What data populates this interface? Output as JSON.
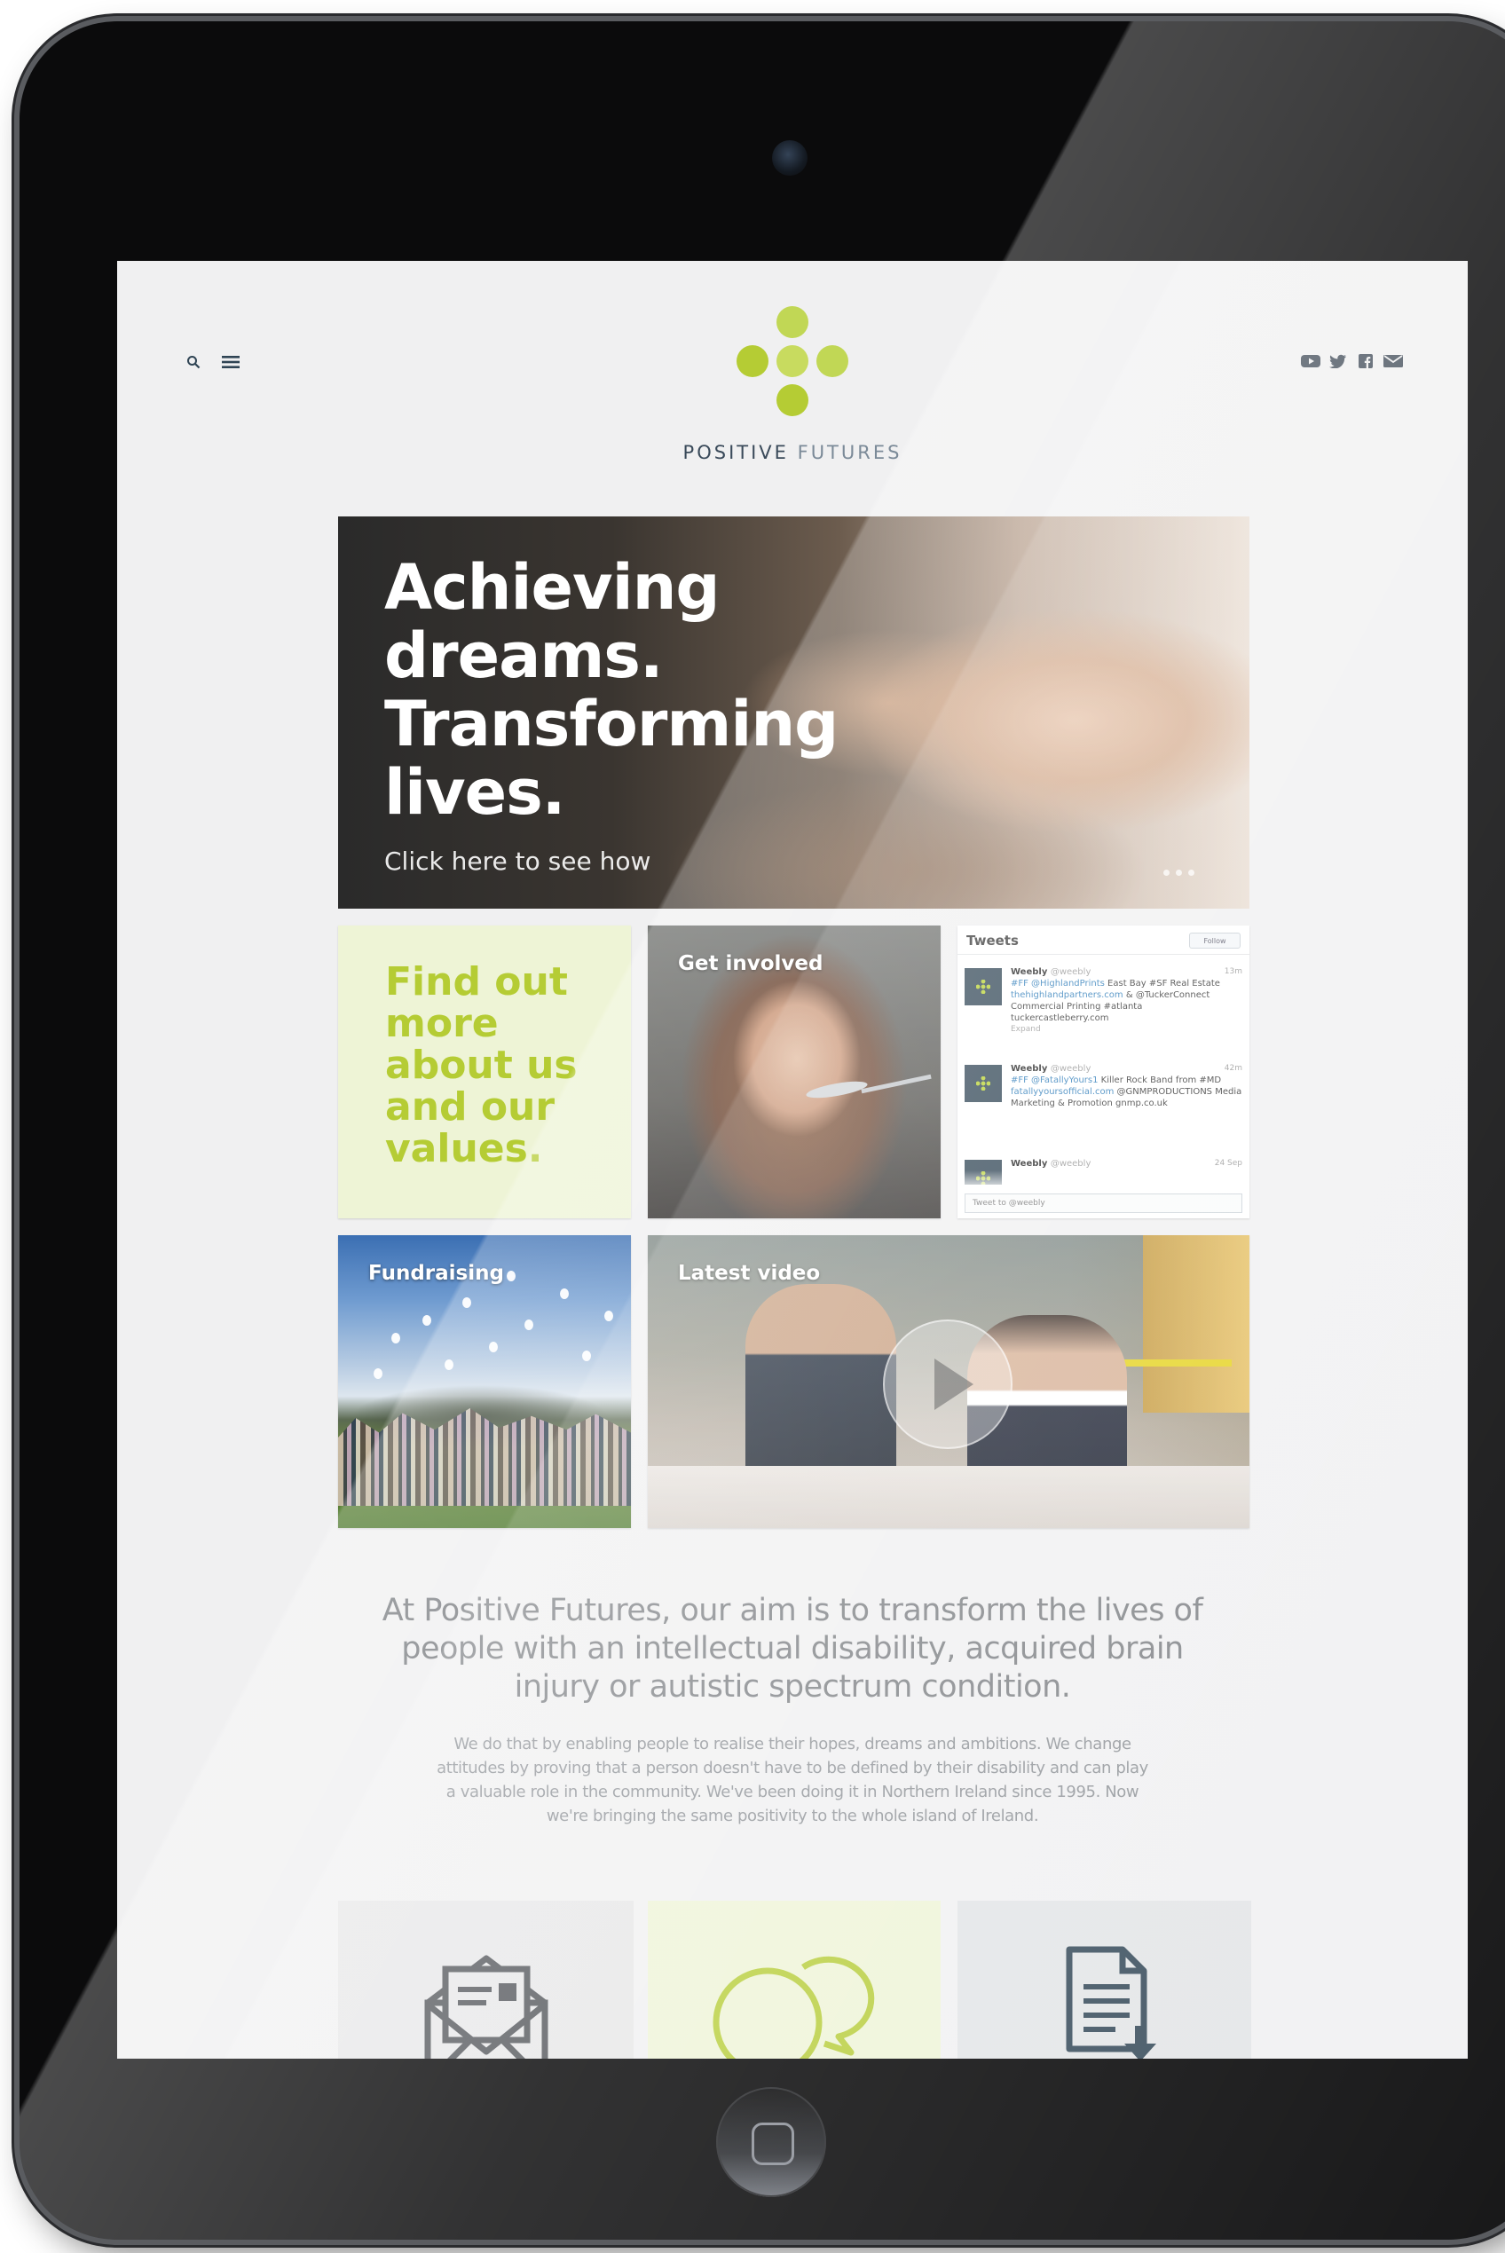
{
  "header": {
    "brand_name_bold": "POSITIVE",
    "brand_name_light": "FUTURES",
    "left_icons": [
      "search-icon",
      "menu-icon"
    ],
    "social_icons": [
      "youtube-icon",
      "twitter-icon",
      "facebook-icon",
      "email-icon"
    ]
  },
  "hero": {
    "title_lines": [
      "Achieving",
      "dreams.",
      "Transforming",
      "lives."
    ],
    "cta": "Click here to see how"
  },
  "tiles": {
    "about_text": "Find out more about us and our values.",
    "get_involved": "Get involved",
    "fundraising": "Fundraising",
    "latest_video": "Latest video"
  },
  "tweets": {
    "title": "Tweets",
    "follow": "Follow",
    "items": [
      {
        "name": "Weebly",
        "handle": "@weebly",
        "time": "13m",
        "text_a": "#FF @HighlandPrints",
        "text_b": " East Bay #SF Real Estate ",
        "text_c": "thehighlandpartners.com",
        "text_d": " & @TuckerConnect Commercial Printing #atlanta tuckercastleberry.com",
        "expand": "Expand"
      },
      {
        "name": "Weebly",
        "handle": "@weebly",
        "time": "42m",
        "text_a": "#FF @FatallyYours1",
        "text_b": " Killer Rock Band from #MD ",
        "text_c": "fatallyyoursofficial.com",
        "text_d": " @GNMPRODUCTIONS Media Marketing & Promotion gnmp.co.uk",
        "expand": ""
      },
      {
        "name": "Weebly",
        "handle": "@weebly",
        "time": "24 Sep",
        "text_a": "",
        "text_b": "",
        "text_c": "",
        "text_d": "",
        "expand": ""
      }
    ],
    "compose_placeholder": "Tweet to @weebly"
  },
  "intro": {
    "lead": "At Positive Futures, our aim is to transform the lives of people with an intellectual disability, acquired brain injury or autistic spectrum condition.",
    "body": "We do that by enabling people to realise their hopes, dreams and ambitions. We change attitudes by proving that a person doesn't have to be defined by their disability and can play a valuable role in the community. We've been doing it in Northern Ireland since 1995. Now we're bringing the same positivity to the whole island of Ireland."
  },
  "bottom_tiles": [
    "envelope-icon",
    "chat-bubbles-icon",
    "document-download-icon"
  ],
  "colors": {
    "brand_green": "#b5cc34",
    "pale_green": "#eef4d6",
    "navy": "#2f4454",
    "text_grey": "#7c7f83"
  }
}
